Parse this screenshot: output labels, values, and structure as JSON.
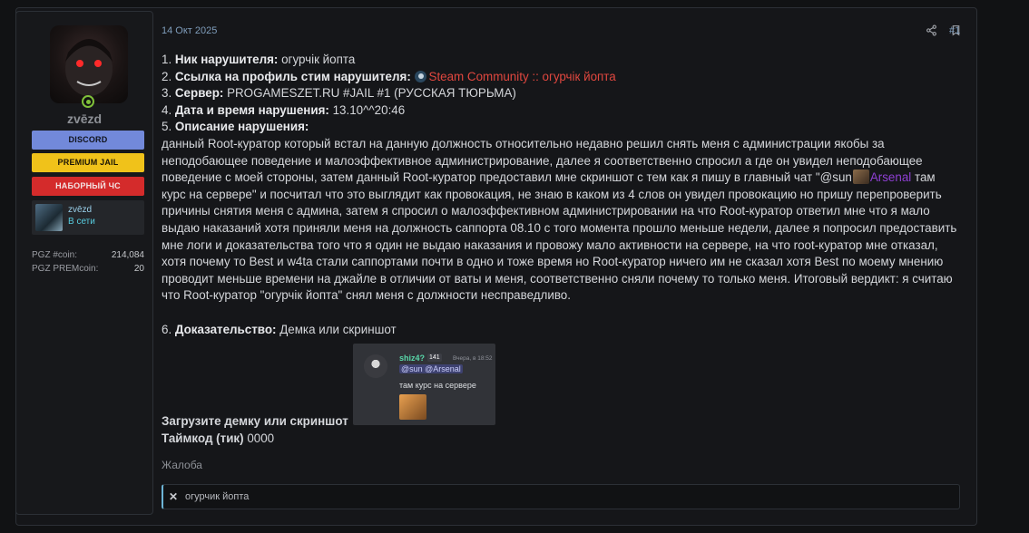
{
  "user": {
    "username": "zvēzd",
    "buttons": {
      "discord": "DISCORD",
      "premium": "PREMIUM JAIL",
      "nabor": "НАБОРНЫЙ ЧС"
    },
    "steam": {
      "name": "zvēzd",
      "status": "В сети"
    },
    "stats": [
      {
        "label": "PGZ #coin:",
        "value": "214,084"
      },
      {
        "label": "PGZ PREMcoin:",
        "value": "20"
      }
    ]
  },
  "post": {
    "date": "14 Окт 2025",
    "number": "#1",
    "icons": [
      "share-icon",
      "bookmark-icon"
    ],
    "lines": {
      "nick_label": "Ник нарушителя:",
      "nick_value": " огурчік йопта",
      "steam_label": "Ссылка на профиль стим нарушителя:",
      "steam_link": "Steam Community :: огурчік йопта",
      "server_label": "Сервер:",
      "server_value": " PROGAMESZET.RU #JAIL #1 (РУССКАЯ ТЮРЬМА)",
      "date_label": "Дата и время нарушения:",
      "date_value": " 13.10^^20:46",
      "desc_label": "Описание нарушения:",
      "desc_1": "данный Root-куратор который встал на данную должность относительно недавно решил снять меня с администрации якобы за неподобающее поведение и малоэффективное администрирование, далее я соответственно спросил а где он увидел неподобающее поведение с моей стороны, затем данный Root-куратор предоставил мне скриншот с тем как я пишу в главный чат \"@sun",
      "desc_mention": "Arsenal",
      "desc_2": " там курс на сервере\" и посчитал что это выглядит как провокация, не знаю в каком из 4 слов он увидел провокацию но пришу перепроверить причины снятия меня с админа, затем я спросил о малоэффективном администрировании на что Root-куратор ответил мне что я мало выдаю наказаний хотя приняли меня на должность саппорта 08.10 с того момента прошло меньше недели, далее я попросил предоставить мне логи и доказательства того что я один не выдаю наказания и провожу мало активности на сервере, на что root-куратор мне отказал, хотя почему то Best и w4ta стали саппортами почти в одно и тоже время но Root-куратор ничего им не сказал хотя Best по моему мнению проводит меньше времени на джайле в отличии от ваты и меня, соответственно сняли почему то только меня. Итоговый вердикт: я считаю что Root-куратор \"огурчік йопта\" снял меня с должности несправедливо.",
      "proof_label": "Доказательство:",
      "proof_value": " Демка или скриншот"
    },
    "screenshot": {
      "name": "shiz4?",
      "badge": "141",
      "time": "Вчера, в 18:52",
      "mention": "@sun @Arsenal",
      "text": "там курс на сервере"
    },
    "upload_label": "Загрузите демку или скриншот",
    "timecode_label": "Таймкод (тик)",
    "timecode_value": " 0000",
    "complaint": "Жалоба",
    "tag": "огурчик йопта"
  }
}
